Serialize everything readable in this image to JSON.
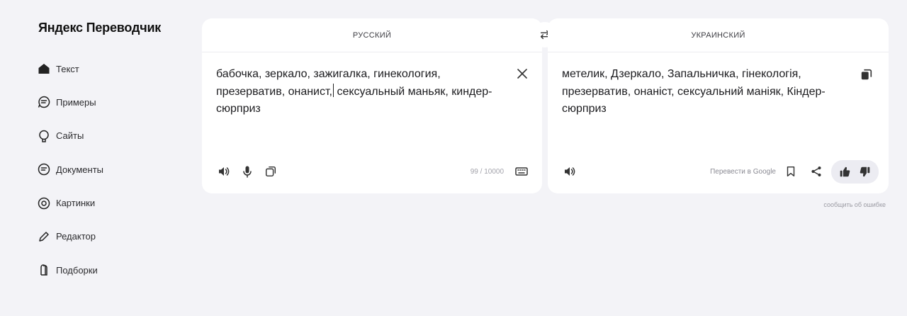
{
  "app": {
    "title": "Яндекс Переводчик"
  },
  "sidebar": {
    "items": [
      {
        "label": "Текст",
        "icon": "home-icon",
        "active": true
      },
      {
        "label": "Примеры",
        "icon": "examples-icon"
      },
      {
        "label": "Сайты",
        "icon": "sites-icon"
      },
      {
        "label": "Документы",
        "icon": "documents-icon"
      },
      {
        "label": "Картинки",
        "icon": "images-icon"
      },
      {
        "label": "Редактор",
        "icon": "editor-icon"
      },
      {
        "label": "Подборки",
        "icon": "collections-icon"
      }
    ]
  },
  "source": {
    "language": "РУССКИЙ",
    "text_before_caret": "бабочка, зеркало, зажигалка, гинекология, презерватив, онанист,",
    "text_after_caret": " сексуальный маньяк, киндер-сюрприз",
    "counter": "99 / 10000"
  },
  "target": {
    "language": "УКРАИНСКИЙ",
    "text": "метелик, Дзеркало, Запальничка, гінекологія, презерватив, онаніст, сексуальний маніяк, Кіндер-сюрприз",
    "google_link": "Перевести в Google"
  },
  "footer": {
    "report_link": "сообщить об ошибке"
  },
  "colors": {
    "background": "#f3f3f7",
    "panel": "#ffffff",
    "rate_bg": "#ececf2"
  }
}
